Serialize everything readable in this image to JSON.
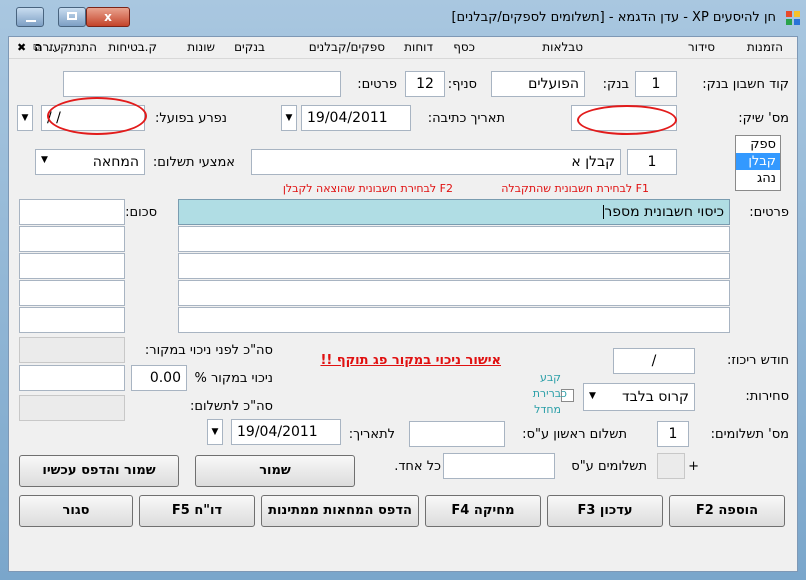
{
  "window": {
    "title": "חן להיסעים XP - עדן הדגמא - [תשלומים לספקים/קבלנים]",
    "minimize_label": "",
    "maximize_label": "",
    "close_label": "x"
  },
  "menubar": {
    "items": [
      "הזמנות",
      "סידור",
      "טבלאות",
      "כסף",
      "דוחות",
      "ספקים/קבלנים",
      "בנקים",
      "שונות",
      "ק.בטיחות",
      "התנתק",
      "עזרה"
    ],
    "restore_label": "✖ ⧉ ‥"
  },
  "form": {
    "bank_account_label": "קוד חשבון בנק:",
    "bank_account_value": "1",
    "bank_label": "בנק:",
    "bank_value": "הפועלים",
    "branch_label": "סניף:",
    "branch_value": "12",
    "details_label": "פרטים:",
    "details_value": "",
    "check_no_label": "מס' שיק:",
    "check_no_value": "",
    "write_date_label": "תאריך כתיבה:",
    "write_date_value": "19/04/2011",
    "cashed_label": "נפרע בפועל:",
    "cashed_value": "/  /",
    "supplier_code_value": "1",
    "supplier_name_value": "קבלן א",
    "payment_method_label": "אמצעי תשלום:",
    "payment_method_value": "המחאה",
    "supplier_type_options": [
      "ספק",
      "קבלן",
      "נהג"
    ],
    "supplier_type_selected": "קבלן",
    "f1_hint": "F1 לבחירת חשבונית שהתקבלה",
    "f2_hint": "F2 לבחירת חשבונית שהוצאה לקבלן",
    "lines_details_label": "פרטים:",
    "sum_label": "סכום:",
    "line1_details": "כיסוי חשבונית מספר",
    "total_before_label": "סה\"כ לפני ניכוי במקור:",
    "withholding_pct_label": "ניכוי במקור %",
    "withholding_pct_value": "0.00",
    "total_pay_label": "סה\"כ לתשלום:",
    "consolidation_month_label": "חודש ריכוז:",
    "consolidation_month_value": "/",
    "warning_text": "אישור ניכוי במקור פג תוקף !!",
    "closing_label": "סחירות:",
    "closing_value": "קרוס בלבד",
    "default_checkbox_label_1": "קבע",
    "default_checkbox_label_2": "כברירת",
    "default_checkbox_label_3": "מחדל",
    "to_date_label": "לתאריך:",
    "to_date_value": "19/04/2011",
    "payments_count_label": "מס' תשלומים:",
    "payments_count_value": "1",
    "first_payment_label": "תשלום ראשון ע\"ס:",
    "first_payment_value": "",
    "payments_of_label": "תשלומים ע\"ס",
    "payments_of_value": "",
    "each_label": "כל אחד.",
    "plus_label": "+"
  },
  "buttons": {
    "save_print": "שמור והדפס עכשיו",
    "save": "שמור",
    "add": "הוספה F2",
    "update": "עדכון F3",
    "delete": "מחיקה F4",
    "print_checks": "הדפס המחאות ממתינות",
    "report": "דו\"ח F5",
    "close": "סגור"
  },
  "colors": {
    "selected_row": "#b0dde4",
    "warning": "#e01010",
    "annotation_circle": "#e21b1b",
    "listbox_selected": "#3399ff"
  }
}
